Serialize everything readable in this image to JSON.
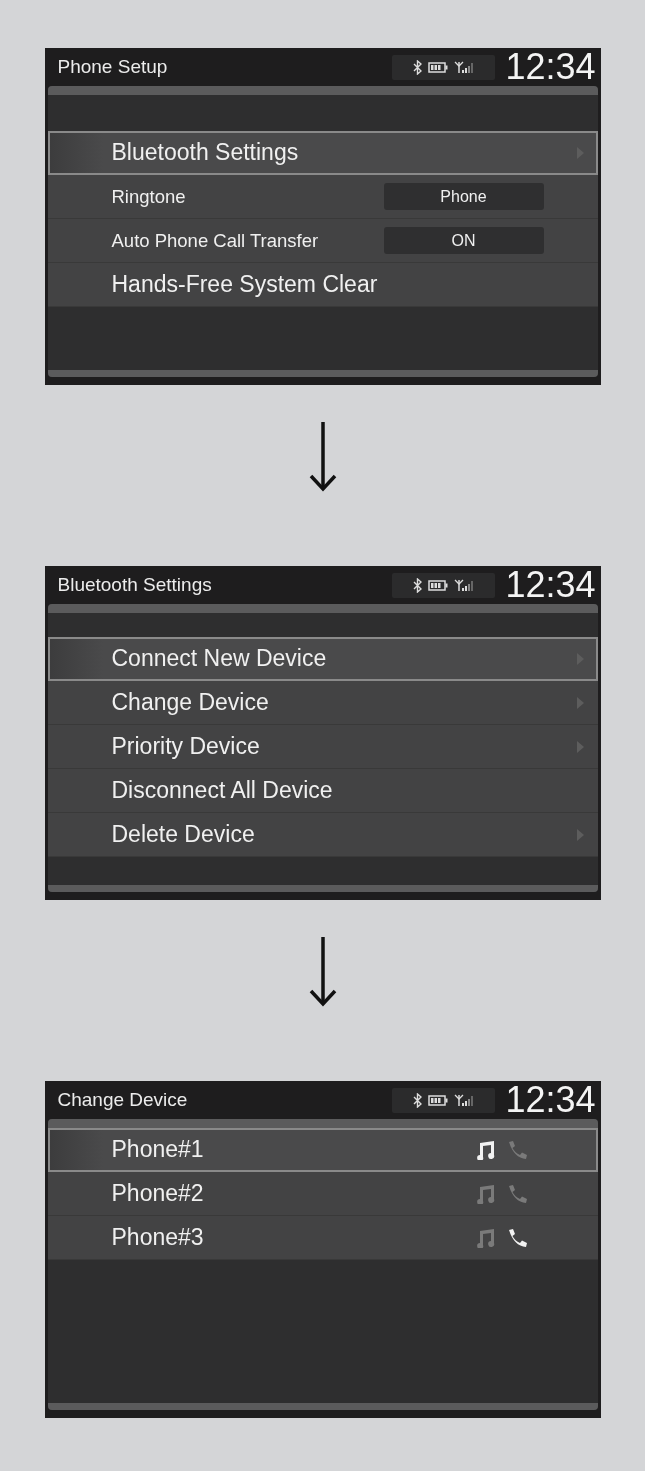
{
  "screens": [
    {
      "title": "Phone Setup",
      "clock": "12:34",
      "rows": [
        {
          "kind": "menu",
          "label": "Bluetooth Settings",
          "selected": true,
          "submenu": true
        },
        {
          "kind": "value",
          "label": "Ringtone",
          "value": "Phone",
          "selected": false
        },
        {
          "kind": "value",
          "label": "Auto Phone Call Transfer",
          "value": "ON",
          "selected": false
        },
        {
          "kind": "menu",
          "label": "Hands-Free System Clear",
          "selected": false,
          "submenu": false
        }
      ]
    },
    {
      "title": "Bluetooth Settings",
      "clock": "12:34",
      "rows": [
        {
          "kind": "menu",
          "label": "Connect New Device",
          "selected": true,
          "submenu": true
        },
        {
          "kind": "menu",
          "label": "Change Device",
          "selected": false,
          "submenu": true
        },
        {
          "kind": "menu",
          "label": "Priority Device",
          "selected": false,
          "submenu": true
        },
        {
          "kind": "menu",
          "label": "Disconnect All Device",
          "selected": false,
          "submenu": false
        },
        {
          "kind": "menu",
          "label": "Delete Device",
          "selected": false,
          "submenu": true
        }
      ]
    },
    {
      "title": "Change Device",
      "clock": "12:34",
      "rows": [
        {
          "kind": "device",
          "label": "Phone#1",
          "selected": true,
          "audio_connected": true,
          "phone_connected": false
        },
        {
          "kind": "device",
          "label": "Phone#2",
          "selected": false,
          "audio_connected": false,
          "phone_connected": false
        },
        {
          "kind": "device",
          "label": "Phone#3",
          "selected": false,
          "audio_connected": false,
          "phone_connected": true
        }
      ]
    }
  ]
}
